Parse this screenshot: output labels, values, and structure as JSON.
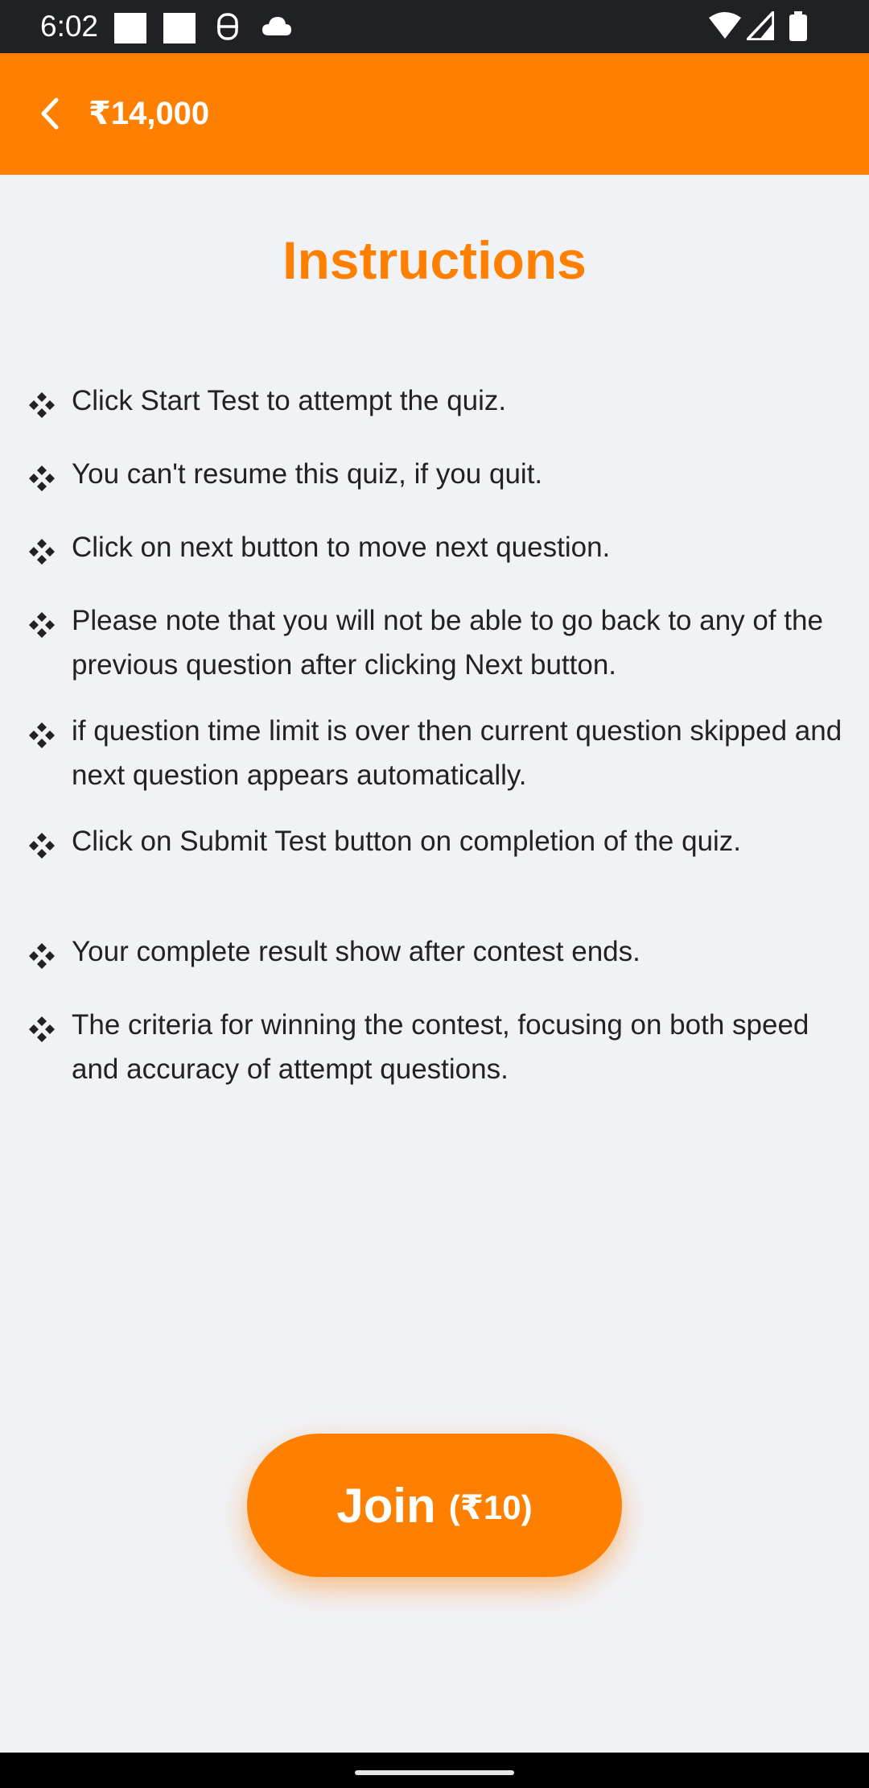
{
  "status_bar": {
    "time": "6:02",
    "icons_left": [
      "notification-square-icon",
      "notification-square-icon",
      "vpn-icon",
      "cloud-icon"
    ],
    "icons_right": [
      "wifi-icon",
      "cellular-signal-icon",
      "battery-icon"
    ]
  },
  "app_bar": {
    "back_icon": "chevron-left-icon",
    "title": "₹14,000",
    "background": "#ff8000"
  },
  "heading": "Instructions",
  "instructions": [
    "Click Start Test to attempt the quiz.",
    "You can't resume this quiz, if you quit.",
    "Click on next button to move next question.",
    "Please note that you will not be able to go back to any of the previous question after clicking Next button.",
    "if question time limit is over then current question skipped and next question appears automatically.",
    "Click on Submit Test button on completion of the quiz.",
    "Your complete result show after contest ends.",
    "The criteria for winning the contest, focusing on both speed and accuracy of attempt questions."
  ],
  "bullet_icon": "four-diamond-bullet-icon",
  "join_button": {
    "label": "Join",
    "fee": "(₹10)"
  },
  "colors": {
    "accent": "#ff8000",
    "background": "#f1f2f6",
    "text": "#222222"
  }
}
